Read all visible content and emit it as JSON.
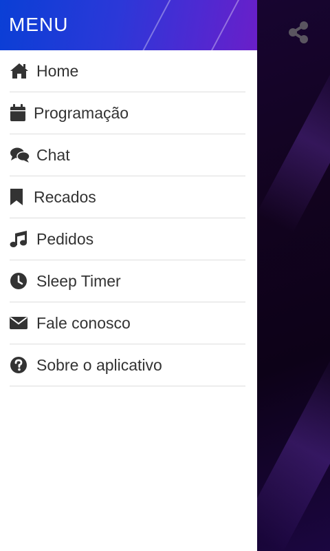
{
  "drawer": {
    "title": "MENU",
    "items": [
      {
        "label": "Home",
        "icon": "home-icon"
      },
      {
        "label": "Programação",
        "icon": "calendar-icon"
      },
      {
        "label": "Chat",
        "icon": "chat-icon"
      },
      {
        "label": "Recados",
        "icon": "bookmark-icon"
      },
      {
        "label": "Pedidos",
        "icon": "music-note-icon"
      },
      {
        "label": "Sleep Timer",
        "icon": "clock-icon"
      },
      {
        "label": "Fale conosco",
        "icon": "envelope-icon"
      },
      {
        "label": "Sobre o aplicativo",
        "icon": "question-circle-icon"
      }
    ]
  },
  "topbar": {
    "share_icon": "share-icon"
  },
  "colors": {
    "header_gradient_start": "#0a3fd6",
    "header_gradient_end": "#6a1fc9",
    "icon_color": "#333333",
    "background": "#12031f"
  }
}
